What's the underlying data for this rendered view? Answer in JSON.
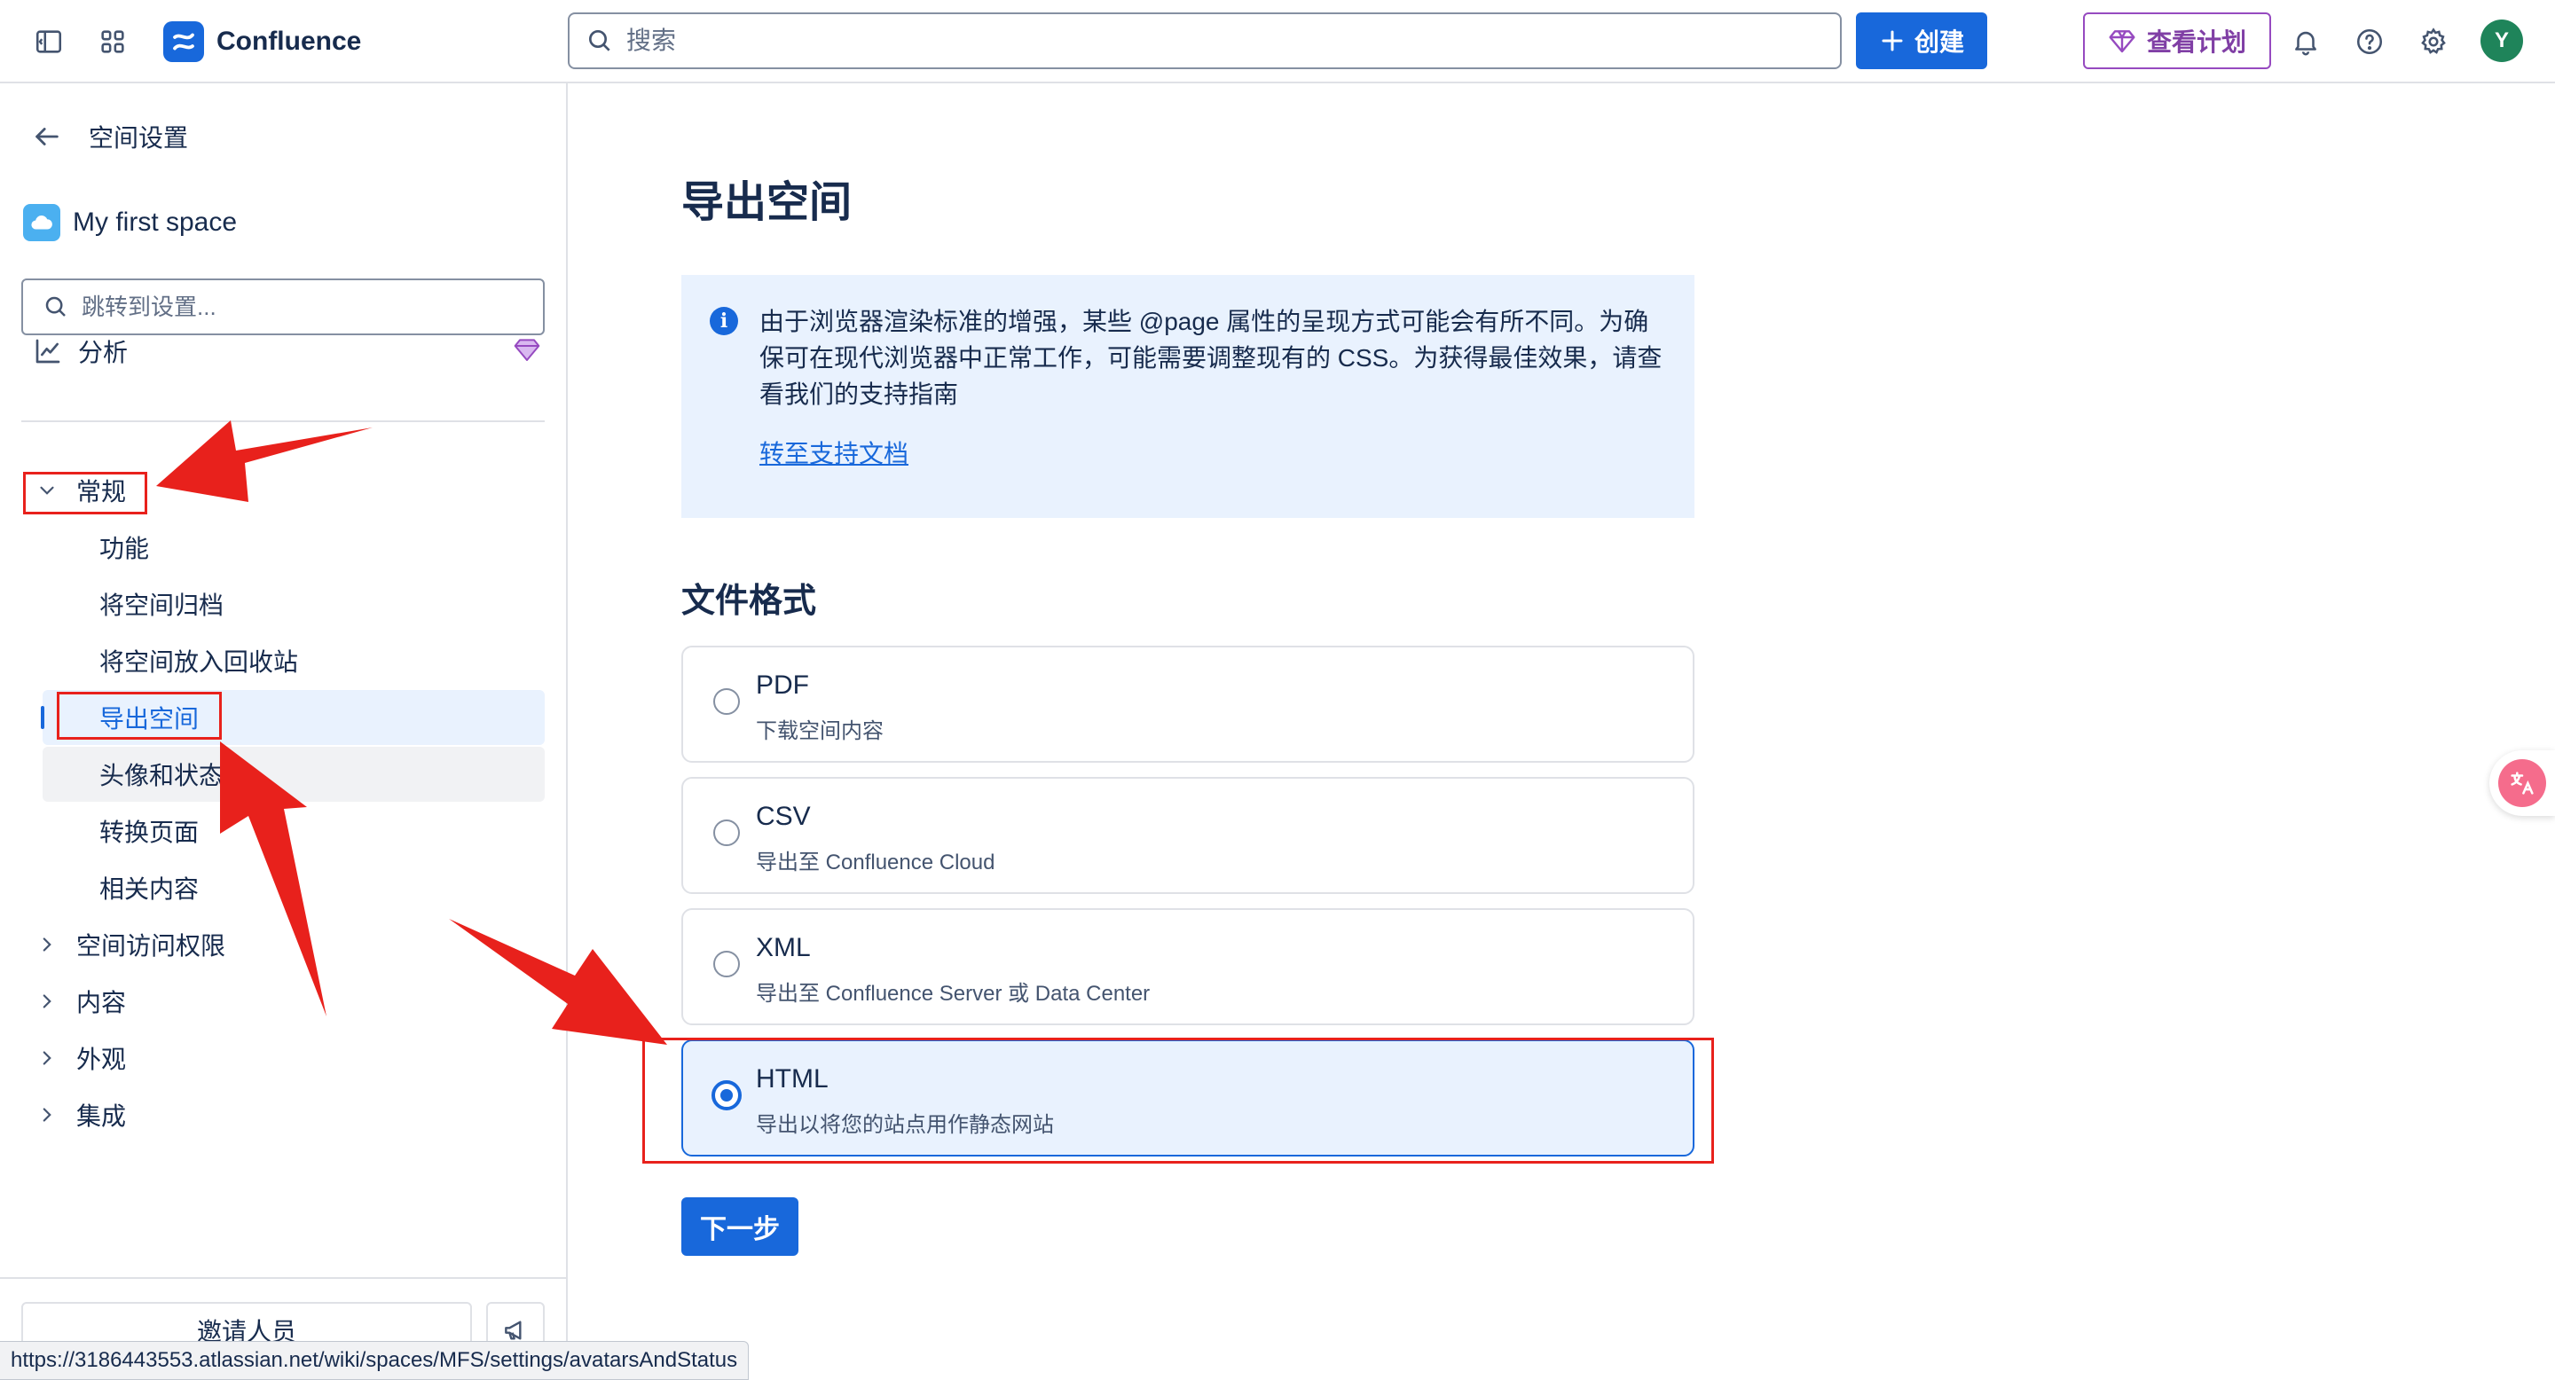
{
  "topbar": {
    "brand": "Confluence",
    "search_placeholder": "搜索",
    "create_label": "创建",
    "plan_label": "查看计划",
    "avatar_initial": "Y"
  },
  "sidebar": {
    "back_label": "空间设置",
    "space_name": "My first space",
    "search_placeholder": "跳转到设置...",
    "analysis_label": "分析",
    "general_label": "常规",
    "general_items": [
      "功能",
      "将空间归档",
      "将空间放入回收站",
      "导出空间",
      "头像和状态",
      "转换页面",
      "相关内容"
    ],
    "selected_item": "导出空间",
    "groups": [
      "空间访问权限",
      "内容",
      "外观",
      "集成"
    ],
    "invite_label": "邀请人员"
  },
  "status_url": "https://3186443553.atlassian.net/wiki/spaces/MFS/settings/avatarsAndStatus",
  "main": {
    "title": "导出空间",
    "info_text": "由于浏览器渲染标准的增强，某些 @page 属性的呈现方式可能会有所不同。为确保可在现代浏览器中正常工作，可能需要调整现有的 CSS。为获得最佳效果，请查看我们的支持指南",
    "info_link": "转至支持文档",
    "format_title": "文件格式",
    "options": [
      {
        "label": "PDF",
        "desc": "下载空间内容",
        "selected": false
      },
      {
        "label": "CSV",
        "desc": "导出至 Confluence Cloud",
        "selected": false
      },
      {
        "label": "XML",
        "desc": "导出至 Confluence Server 或 Data Center",
        "selected": false
      },
      {
        "label": "HTML",
        "desc": "导出以将您的站点用作静态网站",
        "selected": true
      }
    ],
    "next_label": "下一步"
  },
  "colors": {
    "accent": "#1868db",
    "annotation": "#e8211c",
    "plan": "#803fa5",
    "avatar": "#1f845a"
  }
}
